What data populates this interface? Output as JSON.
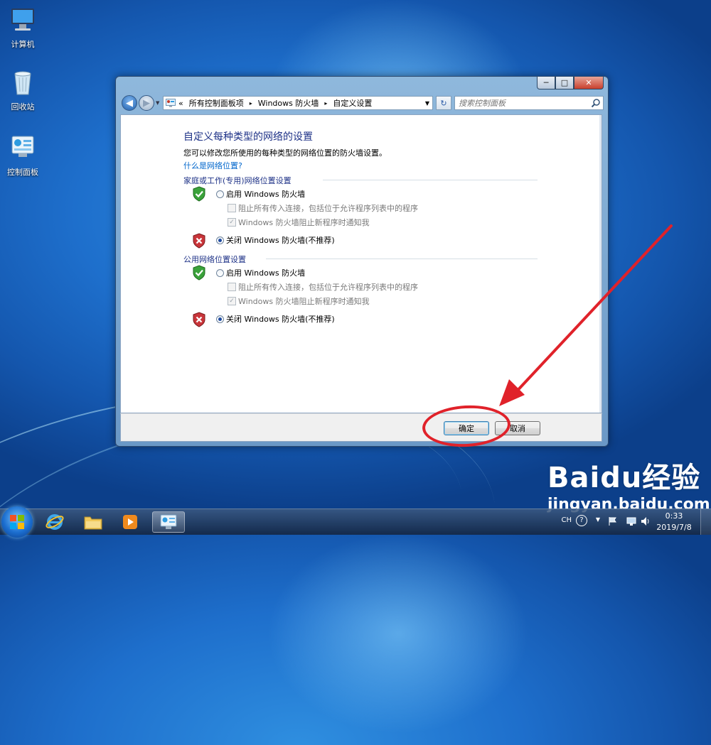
{
  "desktop": {
    "icons": [
      {
        "label": "计算机"
      },
      {
        "label": "回收站"
      },
      {
        "label": "控制面板"
      }
    ]
  },
  "window": {
    "caption_buttons": {
      "minimize": "─",
      "maximize": "□",
      "close": "✕"
    },
    "address": {
      "prefix": "«",
      "segments": [
        "所有控制面板项",
        "Windows 防火墙",
        "自定义设置"
      ],
      "separator": "▸",
      "dropdown": "▼"
    },
    "search": {
      "placeholder": "搜索控制面板"
    },
    "content": {
      "heading": "自定义每种类型的网络的设置",
      "description": "您可以修改您所使用的每种类型的网络位置的防火墙设置。",
      "help_link": "什么是网络位置?",
      "sections": [
        {
          "title": "家庭或工作(专用)网络位置设置",
          "enable_label": "启用 Windows 防火墙",
          "block_label": "阻止所有传入连接，包括位于允许程序列表中的程序",
          "notify_label": "Windows 防火墙阻止新程序时通知我",
          "disable_label": "关闭 Windows 防火墙(不推荐)",
          "selected": "disable"
        },
        {
          "title": "公用网络位置设置",
          "enable_label": "启用 Windows 防火墙",
          "block_label": "阻止所有传入连接，包括位于允许程序列表中的程序",
          "notify_label": "Windows 防火墙阻止新程序时通知我",
          "disable_label": "关闭 Windows 防火墙(不推荐)",
          "selected": "disable"
        }
      ]
    },
    "footer": {
      "ok_label": "确定",
      "cancel_label": "取消"
    }
  },
  "taskbar": {
    "tray": {
      "language": "CH",
      "help": "?",
      "time": "0:33",
      "date": "2019/7/8"
    }
  },
  "watermark": {
    "logo": "Baidu经验",
    "url": "jingyan.baidu.com"
  },
  "colors": {
    "annotation": "#e0222a",
    "heading": "#1e3287",
    "link": "#0066cc"
  }
}
